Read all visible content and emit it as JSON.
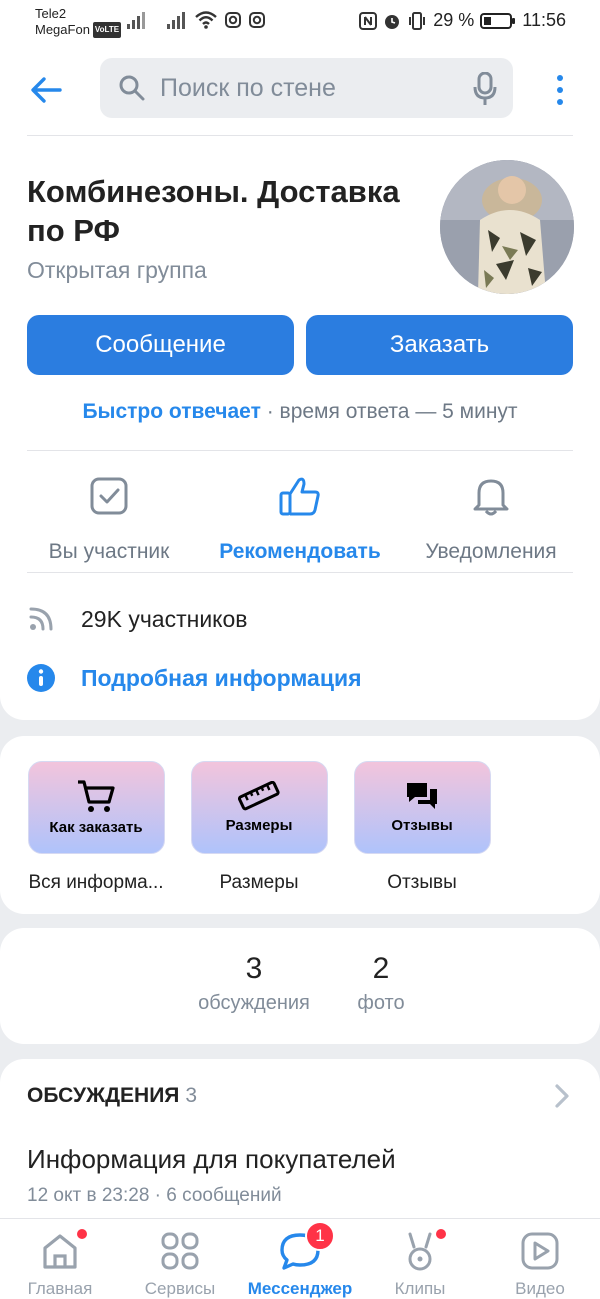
{
  "status_bar": {
    "carrier1": "Tele2",
    "carrier2": "MegaFon",
    "volte": "VoLTE",
    "battery": "29 %",
    "time": "11:56"
  },
  "header": {
    "search_placeholder": "Поиск по стене",
    "icons": [
      "back-arrow-icon",
      "search-icon",
      "microphone-icon",
      "more-icon"
    ]
  },
  "group": {
    "title": "Комбинезоны. Доставка по РФ",
    "type": "Открытая группа"
  },
  "buttons": {
    "message": "Сообщение",
    "order": "Заказать"
  },
  "response": {
    "fast": "Быстро отвечает",
    "separator": " · ",
    "time": "время ответа — 5 минут"
  },
  "actions": [
    {
      "label": "Вы участник",
      "icon": "checkbox-icon"
    },
    {
      "label": "Рекомендовать",
      "icon": "like-icon"
    },
    {
      "label": "Уведомления",
      "icon": "bell-icon"
    }
  ],
  "info": {
    "members": "29K участников",
    "more": "Подробная информация"
  },
  "links": [
    {
      "tile": "Как заказать",
      "caption": "Вся информа...",
      "icon": "cart-icon"
    },
    {
      "tile": "Размеры",
      "caption": "Размеры",
      "icon": "ruler-icon"
    },
    {
      "tile": "Отзывы",
      "caption": "Отзывы",
      "icon": "chat-icon"
    }
  ],
  "counters": [
    {
      "value": "3",
      "label": "обсуждения"
    },
    {
      "value": "2",
      "label": "фото"
    }
  ],
  "discussions": {
    "title": "ОБСУЖДЕНИЯ",
    "count": "3",
    "topic_title": "Информация для покупателей",
    "topic_meta": "12 окт в 23:28 · 6 сообщений"
  },
  "tabs": [
    {
      "label": "Главная",
      "icon": "home-icon",
      "dot": true
    },
    {
      "label": "Сервисы",
      "icon": "services-icon"
    },
    {
      "label": "Мессенджер",
      "icon": "messenger-icon",
      "active": true,
      "badge": "1"
    },
    {
      "label": "Клипы",
      "icon": "clips-icon",
      "dot": true
    },
    {
      "label": "Видео",
      "icon": "video-icon"
    }
  ],
  "colors": {
    "accent": "#2688eb",
    "button": "#2b7de0",
    "badge": "#ff3347",
    "background": "#ebedf0"
  }
}
